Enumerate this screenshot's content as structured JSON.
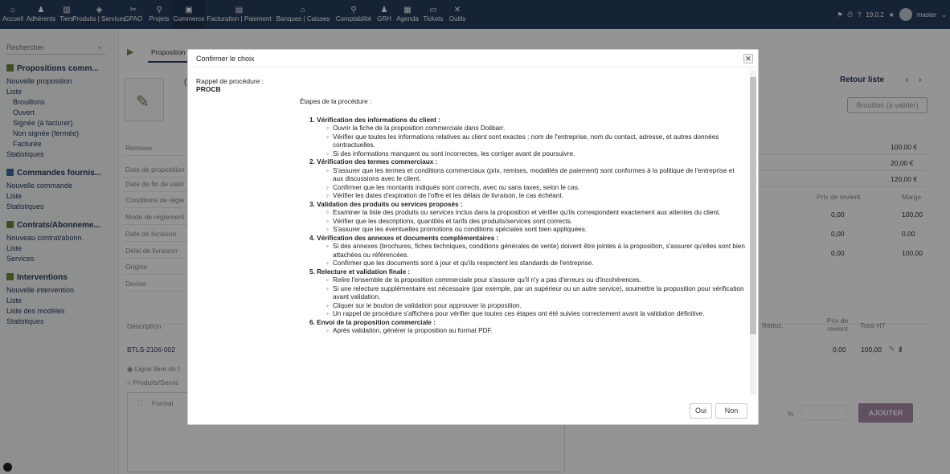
{
  "topbar": {
    "menus": [
      {
        "label": "Accueil",
        "icon": "home-icon",
        "glyph": "⌂"
      },
      {
        "label": "Adhérents",
        "icon": "user-icon",
        "glyph": "♟"
      },
      {
        "label": "Tiers",
        "icon": "building-icon",
        "glyph": "▥"
      },
      {
        "label": "Produits | Services",
        "icon": "cube-icon",
        "glyph": "◈"
      },
      {
        "label": "GPAO",
        "icon": "tools-icon",
        "glyph": "✂"
      },
      {
        "label": "Projets",
        "icon": "sitemap-icon",
        "glyph": "⚲"
      },
      {
        "label": "Commerce",
        "icon": "suitcase-icon",
        "glyph": "▣"
      },
      {
        "label": "Facturation | Paiement",
        "icon": "invoice-icon",
        "glyph": "▤"
      },
      {
        "label": "Banques | Caisses",
        "icon": "bank-icon",
        "glyph": "⌂"
      },
      {
        "label": "Comptabilité",
        "icon": "search-dollar-icon",
        "glyph": "⚲"
      },
      {
        "label": "GRH",
        "icon": "users-icon",
        "glyph": "♟"
      },
      {
        "label": "Agenda",
        "icon": "calendar-icon",
        "glyph": "▦"
      },
      {
        "label": "Tickets",
        "icon": "ticket-icon",
        "glyph": "▭"
      },
      {
        "label": "Outils",
        "icon": "wrench-icon",
        "glyph": "✕"
      }
    ],
    "version": "19.0.2",
    "user": "master"
  },
  "leftmenu": {
    "search_placeholder": "Rechercher",
    "sections": [
      {
        "title": "Propositions comm...",
        "items": [
          "Nouvelle proposition",
          "Liste"
        ],
        "sub": [
          "Brouillons",
          "Ouvert",
          "Signée (à facturer)",
          "Non signée (fermée)",
          "Facturée"
        ],
        "tail": [
          "Statistiques"
        ]
      },
      {
        "title": "Commandes fournis...",
        "items": [
          "Nouvelle commande",
          "Liste",
          "Statistiques"
        ]
      },
      {
        "title": "Contrats/Abonneme...",
        "items": [
          "Nouveau contrat/abonn.",
          "Liste",
          "Services"
        ]
      },
      {
        "title": "Interventions",
        "items": [
          "Nouvelle intervention",
          "Liste",
          "Liste des modèles",
          "Statistiques"
        ]
      }
    ]
  },
  "main": {
    "tab_label": "Proposition",
    "ref_partial": "(",
    "back_link": "Retour liste",
    "status_badge": "Brouillon (à valider)",
    "fields": [
      "Remises",
      "Date de proposition",
      "Date de fin de valid",
      "Conditions de règle",
      "Mode de règlement",
      "Date de livraison",
      "Délai de livraison",
      "Origine",
      "Devise"
    ],
    "amounts": [
      "100,00 €",
      "20,00 €",
      "120,00 €"
    ],
    "margin_headers": [
      "Prix de revient",
      "Marge"
    ],
    "margin_rows": [
      [
        "0,00",
        "100,00"
      ],
      [
        "0,00",
        "0,00"
      ],
      [
        "0,00",
        "100,00"
      ]
    ],
    "lines_headers": {
      "description": "Description",
      "reduc": "Réduc.",
      "prix_revient": "Prix de revient",
      "total_ht": "Total HT"
    },
    "line": {
      "ref": "BTLS-2106-002",
      "prix_revient": "0,00",
      "total_ht": "100,00"
    },
    "radio_free": "Ligne libre de t",
    "radio_prod": "Produits/Servic",
    "format_label": "Format",
    "percent": "%",
    "add_button": "AJOUTER"
  },
  "dialog": {
    "title": "Confirmer le choix",
    "rappel_label": "Rappel de procédure :",
    "rappel_code": "PROCB",
    "intro": "Étapes de la procédure :",
    "steps": [
      {
        "title": "1. Vérification des informations du client :",
        "bullets": [
          "Ouvrir la fiche de la proposition commerciale dans Dolibarr.",
          "Vérifier que toutes les informations relatives au client sont exactes : nom de l'entreprise, nom du contact, adresse, et autres données contractuelles.",
          "Si des informations manquent ou sont incorrectes, les corriger avant de poursuivre."
        ]
      },
      {
        "title": "2. Vérification des termes commerciaux :",
        "bullets": [
          "S'assurer que les termes et conditions commerciaux (prix, remises, modalités de paiement) sont conformes à la politique de l'entreprise et aux discussions avec le client.",
          "Confirmer que les montants indiqués sont corrects, avec ou sans taxes, selon le cas.",
          "Vérifier les dates d'expiration de l'offre et les délais de livraison, le cas échéant."
        ]
      },
      {
        "title": "3. Validation des produits ou services proposés :",
        "bullets": [
          "Examiner la liste des produits ou services inclus dans la proposition et vérifier qu'ils correspondent exactement aux attentes du client.",
          "Vérifier que les descriptions, quantités et tarifs des produits/services sont corrects.",
          "S'assurer que les éventuelles promotions ou conditions spéciales sont bien appliquées."
        ]
      },
      {
        "title": "4. Vérification des annexes et documents complémentaires :",
        "bullets": [
          "Si des annexes (brochures, fiches techniques, conditions générales de vente) doivent être jointes à la proposition, s'assurer qu'elles sont bien attachées ou référencées.",
          "Confirmer que les documents sont à jour et qu'ils respectent les standards de l'entreprise."
        ]
      },
      {
        "title": "5. Relecture et validation finale :",
        "bullets": [
          "Relire l'ensemble de la proposition commerciale pour s'assurer qu'il n'y a pas d'erreurs ou d'incohérences.",
          "Si une relecture supplémentaire est nécessaire (par exemple, par un supérieur ou un autre service), soumettre la proposition pour vérification avant validation.",
          "Cliquer sur le bouton de validation pour approuver la proposition.",
          "Un rappel de procédure s'affichera pour vérifier que toutes ces étapes ont été suivies correctement avant la validation définitive."
        ]
      },
      {
        "title": "6. Envoi de la proposition commerciale :",
        "bullets": [
          "Après validation, générer la proposition au format PDF."
        ]
      }
    ],
    "yes_label": "Oui",
    "no_label": "Non"
  },
  "colors": {
    "topbar": "#263c5c",
    "accent": "#263c5c",
    "add_button": "#a58aa9"
  }
}
